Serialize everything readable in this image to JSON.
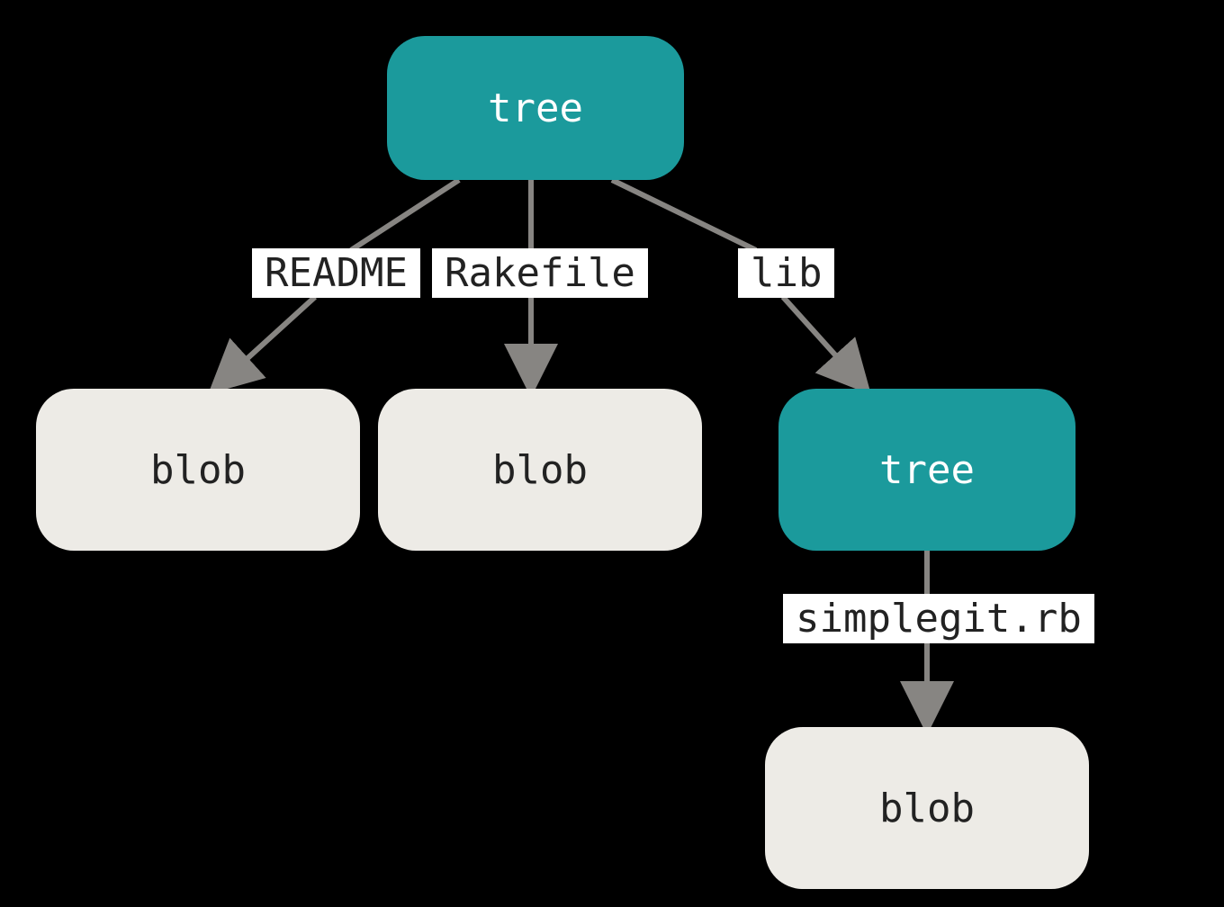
{
  "nodes": {
    "root": {
      "label": "tree"
    },
    "blob1": {
      "label": "blob"
    },
    "blob2": {
      "label": "blob"
    },
    "subtree": {
      "label": "tree"
    },
    "blob3": {
      "label": "blob"
    }
  },
  "edges": {
    "readme": {
      "label": "README"
    },
    "rakefile": {
      "label": "Rakefile"
    },
    "lib": {
      "label": "lib"
    },
    "simplegit": {
      "label": "simplegit.rb"
    }
  },
  "colors": {
    "tree_bg": "#1b9a9c",
    "blob_bg": "#edebe6",
    "label_bg": "#ffffff",
    "arrow": "#878582"
  }
}
